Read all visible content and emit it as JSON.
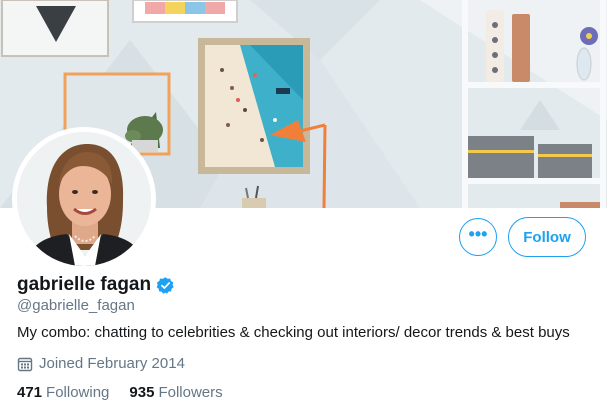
{
  "profile": {
    "display_name": "gabrielle fagan",
    "handle": "@gabrielle_fagan",
    "bio": "My combo: chatting to celebrities & checking out interiors/ decor trends & best buys",
    "joined": "Joined February 2014",
    "verified_icon": "verified-badge-icon",
    "stats": {
      "following_count": "471",
      "following_label": "Following",
      "followers_count": "935",
      "followers_label": "Followers"
    }
  },
  "actions": {
    "more_label": "•••",
    "follow_label": "Follow"
  },
  "icons": {
    "calendar": "calendar-icon",
    "more": "more-options-icon",
    "verified": "verified-badge-icon"
  },
  "colors": {
    "accent": "#1da1f2",
    "secondary_text": "#657786",
    "primary_text": "#14171a"
  }
}
